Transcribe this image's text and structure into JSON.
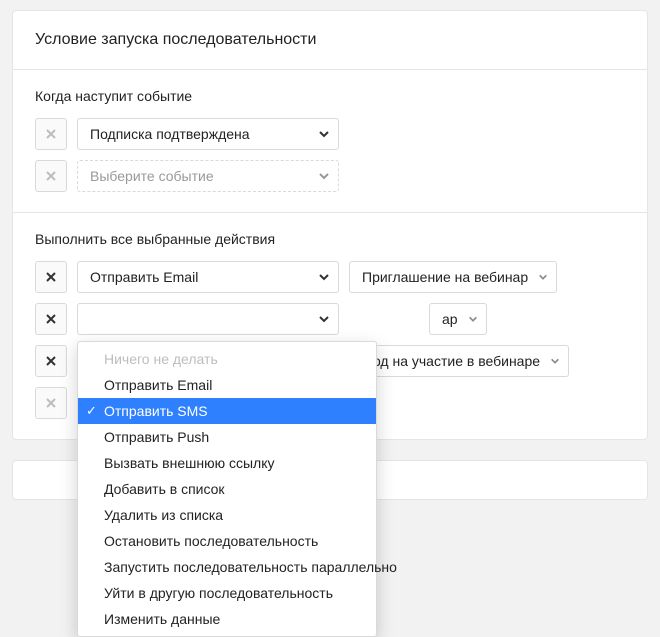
{
  "title": "Условие запуска последовательности",
  "events": {
    "label": "Когда наступит событие",
    "rows": [
      {
        "value": "Подписка подтверждена",
        "placeholder": false,
        "removable": false
      },
      {
        "value": "Выберите событие",
        "placeholder": true,
        "removable": false
      }
    ]
  },
  "actions": {
    "label": "Выполнить все выбранные действия",
    "rows": [
      {
        "action": "Отправить Email",
        "param": "Приглашение на вебинар",
        "removable": true
      },
      {
        "action": "",
        "param": "ар",
        "removable": true,
        "open": true
      },
      {
        "action": "",
        "param": "-код на участие в вебинаре",
        "removable": true
      },
      {
        "action": "",
        "param": "",
        "removable": false,
        "placeholder": true
      }
    ],
    "dropdown": [
      {
        "label": "Ничего не делать",
        "disabled": true
      },
      {
        "label": "Отправить Email"
      },
      {
        "label": "Отправить SMS",
        "selected": true
      },
      {
        "label": "Отправить Push"
      },
      {
        "label": "Вызвать внешнюю ссылку"
      },
      {
        "label": "Добавить в список"
      },
      {
        "label": "Удалить из списка"
      },
      {
        "label": "Остановить последовательность"
      },
      {
        "label": "Запустить последовательность параллельно"
      },
      {
        "label": "Уйти в другую последовательность"
      },
      {
        "label": "Изменить данные"
      }
    ]
  }
}
